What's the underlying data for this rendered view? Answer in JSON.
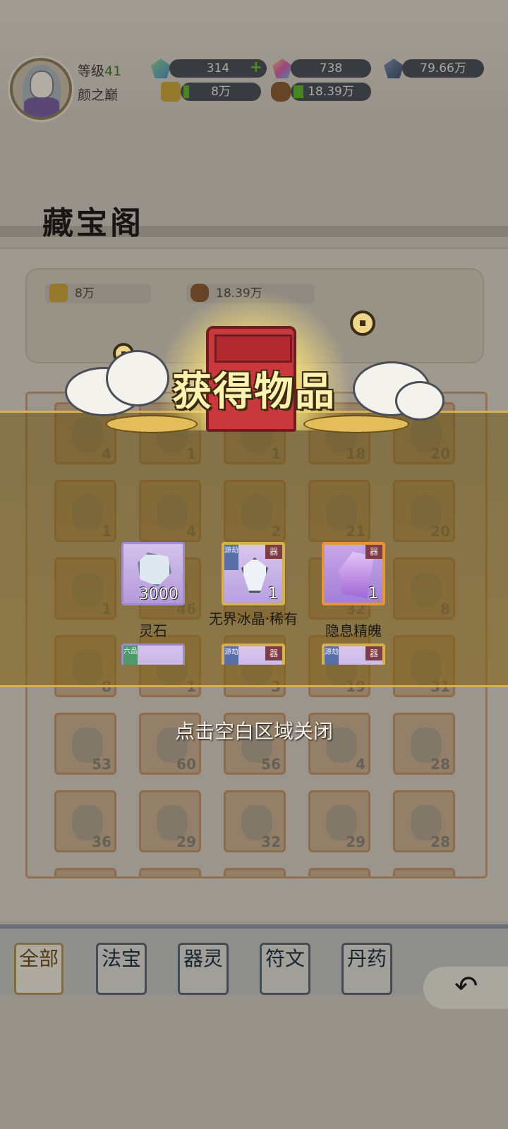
{
  "player": {
    "level_label": "等级",
    "level_value": "41",
    "name": "颜之巅"
  },
  "resources": {
    "gem_green": "314",
    "gem_rainbow": "738",
    "crystal_blue": "79.66万",
    "gold": "8万",
    "ore": "18.39万"
  },
  "page_title": "藏宝阁",
  "currency_box": {
    "gold": "8万",
    "ore": "18.39万"
  },
  "inventory_counts": [
    [
      "4",
      "1",
      "1",
      "18",
      "20"
    ],
    [
      "1",
      "4",
      "2",
      "21",
      "20"
    ],
    [
      "1",
      "46",
      "",
      "32",
      "8"
    ],
    [
      "8",
      "1",
      "3",
      "19",
      "31"
    ],
    [
      "53",
      "60",
      "56",
      "4",
      "28"
    ],
    [
      "36",
      "29",
      "32",
      "29",
      "28"
    ]
  ],
  "tabs": [
    "全部",
    "法宝",
    "器灵",
    "符文",
    "丹药"
  ],
  "modal": {
    "title": "获得物品",
    "items": [
      {
        "name": "灵石",
        "qty": "3000"
      },
      {
        "name": "无界冰晶·稀有",
        "qty": "1",
        "corner": "器",
        "side": "源劫"
      },
      {
        "name": "隐息精魄",
        "qty": "1",
        "corner": "器"
      }
    ],
    "partial_items": [
      {
        "side": "六品"
      },
      {
        "side": "源劫",
        "corner": "器"
      },
      {
        "side": "源劫",
        "corner": "器"
      }
    ],
    "close_hint": "点击空白区域关闭"
  },
  "colors": {
    "accent_gold": "#d8b04c",
    "chest_red": "#c8383d",
    "tab_active": "#b59055"
  }
}
